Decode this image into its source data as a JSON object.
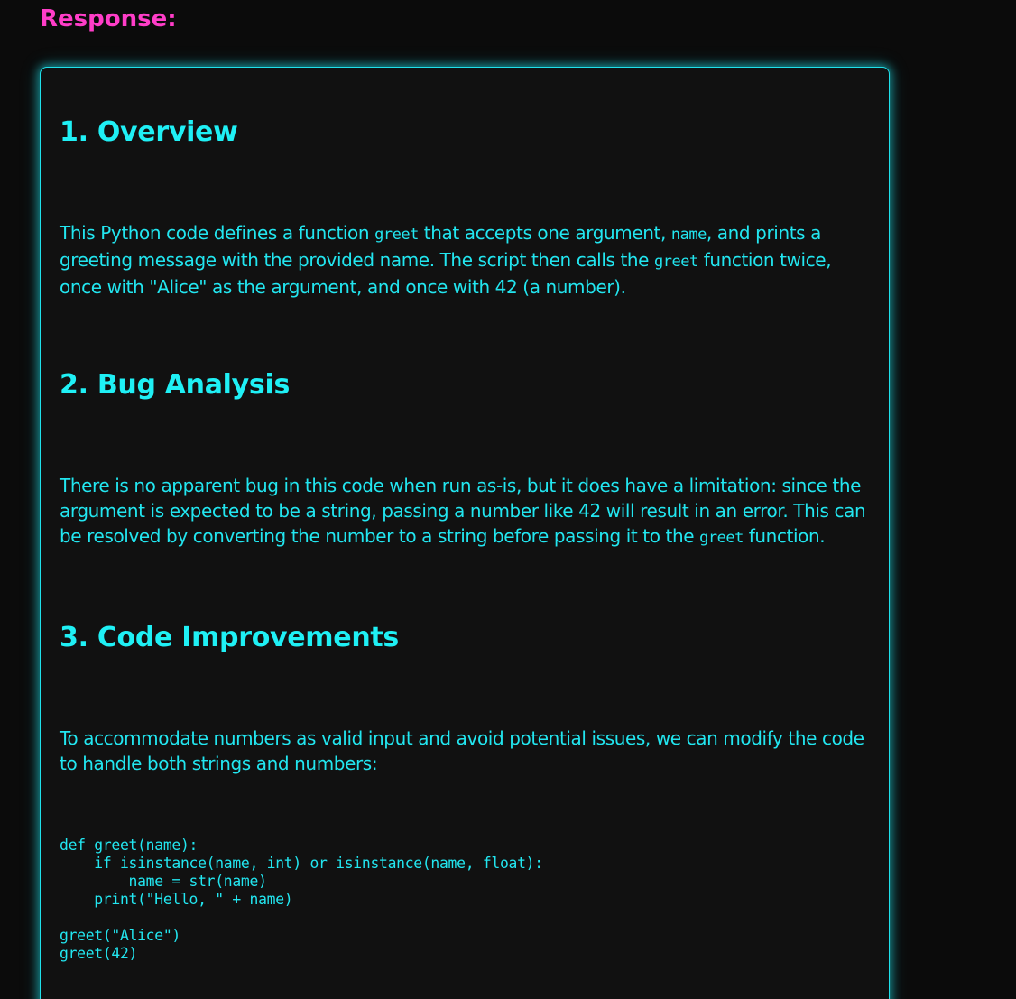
{
  "response_label": "Response:",
  "sections": [
    {
      "title": "1. Overview",
      "paragraph": {
        "t1": "This Python code defines a function ",
        "c1": "greet",
        "t2": " that accepts one argument, ",
        "c2": "name",
        "t3": ", and prints a greeting message with the provided name. The script then calls the ",
        "c3": "greet",
        "t4": " function twice, once with \"Alice\" as the argument, and once with 42 (a number)."
      }
    },
    {
      "title": "2. Bug Analysis",
      "paragraph": {
        "t1": "There is no apparent bug in this code when run as-is, but it does have a limitation: since the argument is expected to be a string, passing a number like 42 will result in an error. This can be resolved by converting the number to a string before passing it to the ",
        "c1": "greet",
        "t2": " function."
      }
    },
    {
      "title": "3. Code Improvements",
      "paragraph": {
        "t1": "To accommodate numbers as valid input and avoid potential issues, we can modify the code to handle both strings and numbers:"
      },
      "code": "def greet(name):\n    if isinstance(name, int) or isinstance(name, float):\n        name = str(name)\n    print(\"Hello, \" + name)\n\ngreet(\"Alice\")\ngreet(42)"
    }
  ]
}
